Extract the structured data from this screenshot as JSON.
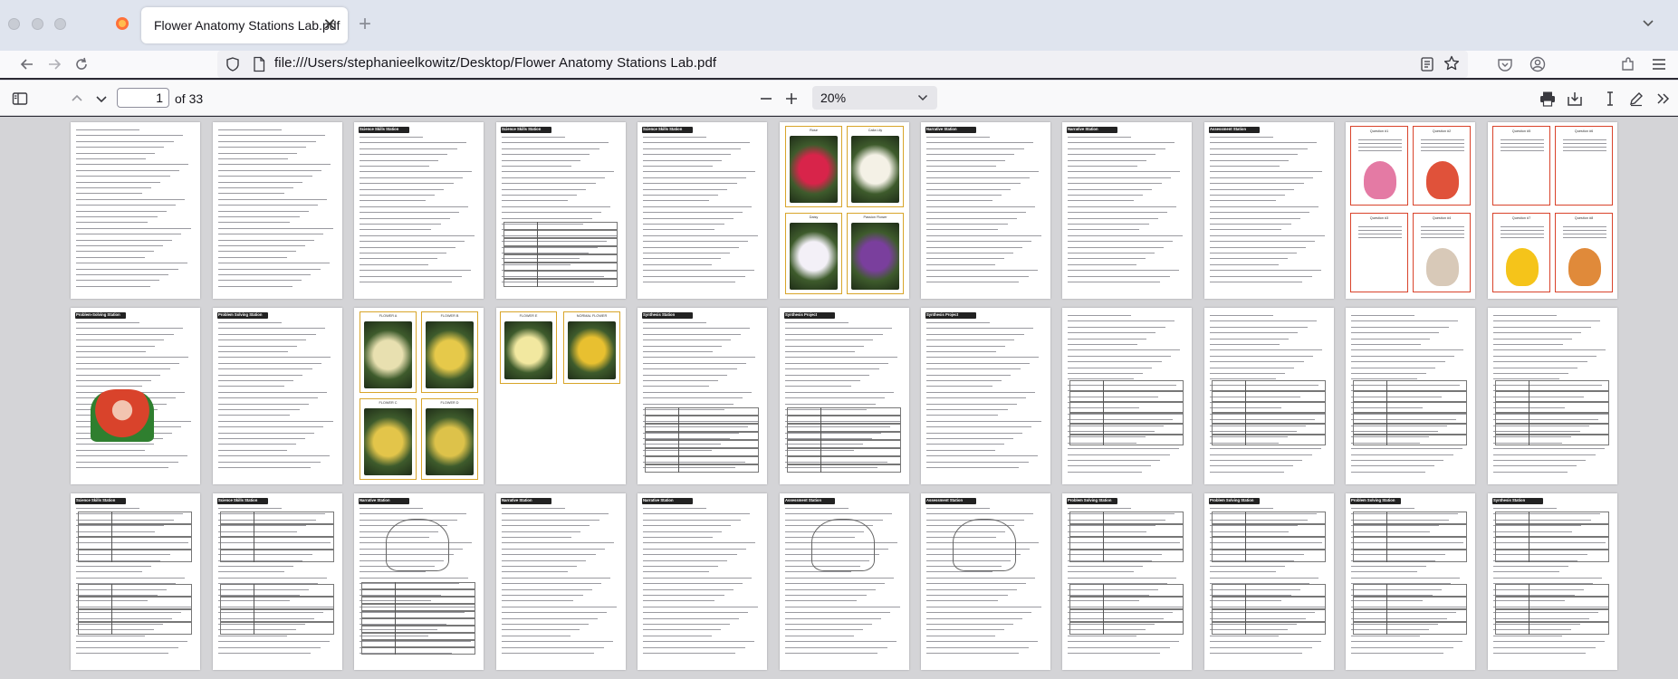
{
  "browser": {
    "tab": {
      "title": "Flower Anatomy Stations Lab.pdf",
      "close": "✕"
    },
    "new_tab": "+",
    "url": "file:///Users/stephanieelkowitz/Desktop/Flower Anatomy Stations Lab.pdf"
  },
  "pdf_toolbar": {
    "page_number": "1",
    "page_count": "of 33",
    "zoom": "20%"
  },
  "colors": {
    "accent_red": "#d9432b",
    "station_header": "#222222",
    "photo_border": "#d8a52a",
    "viewer_bg": "#d4d4d7"
  },
  "thumbnails": {
    "row1": [
      "",
      "",
      "Science Skills Station",
      "Science Skills Station",
      "Science Skills Station",
      "Rose",
      "Narrative Station",
      "Narrative Station",
      "Assessment Station",
      "Question #1",
      "Question #5"
    ],
    "row2": [
      "Problem-Solving Station",
      "Problem Solving Station",
      "FLOWER A",
      "FLOWER C",
      "Synthesis Station",
      "Synthesis Project",
      "Synthesis Project",
      "",
      "",
      "",
      ""
    ],
    "row3": [
      "Science Skills Station",
      "Science Skills Station",
      "Narrative Station",
      "Narrative Station",
      "Narrative Station",
      "Assessment Station",
      "Assessment Station",
      "Problem Solving Station",
      "Problem Solving Station",
      "Problem Solving Station",
      "Synthesis Station"
    ],
    "photo_labels": [
      "Rose",
      "Calla Lily",
      "Daisy",
      "Passion Flower",
      "FLOWER A",
      "FLOWER B",
      "FLOWER C",
      "FLOWER D",
      "FLOWER E",
      "NORMAL FLOWER"
    ],
    "card_labels": [
      "Question #1",
      "Question #2",
      "Question #3",
      "Question #4",
      "Question #5",
      "Question #6",
      "Question #7",
      "Question #8",
      "BONUS Question #7",
      "BONUS Question #8"
    ]
  }
}
